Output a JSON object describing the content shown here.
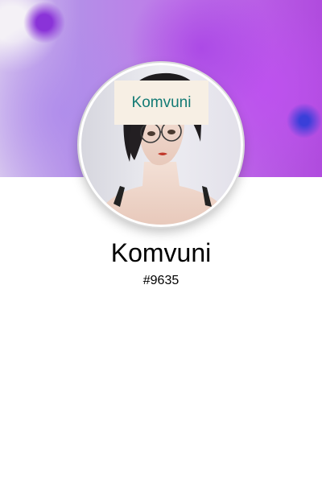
{
  "profile": {
    "tag_label": "Komvuni",
    "username": "Komvuni",
    "discriminator": "#9635"
  },
  "colors": {
    "tag_text": "#127a74",
    "tag_background": "#f7efe4",
    "banner_accent": "#b95ee6"
  },
  "icons": {
    "avatar": "avatar-portrait-illustration"
  }
}
